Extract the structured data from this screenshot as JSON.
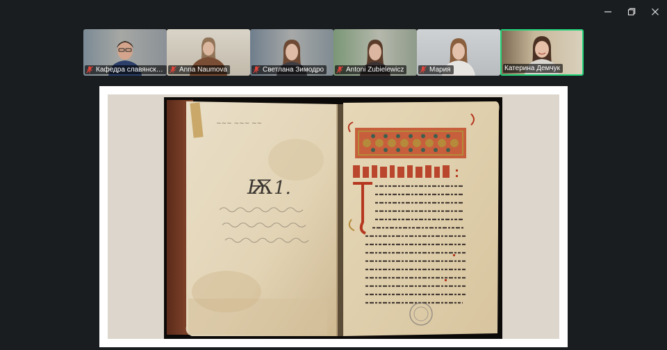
{
  "window": {
    "controls": {
      "minimize_icon": "minimize-icon",
      "maximize_icon": "maximize-icon",
      "close_icon": "close-icon"
    }
  },
  "participants": [
    {
      "name": "Кафедра славянской ...",
      "muted": true,
      "bg": "#8f9499"
    },
    {
      "name": "Anna Naumova",
      "muted": true,
      "bg": "#c5c0b5"
    },
    {
      "name": "Светлана Зимодро",
      "muted": true,
      "bg": "#9aa0a6"
    },
    {
      "name": "Antoni Zubielewicz",
      "muted": true,
      "bg": "#8fa38d"
    },
    {
      "name": "Мария",
      "muted": true,
      "bg": "#c2c6c9"
    },
    {
      "name": "Катерина Демчук",
      "muted": false,
      "bg": "#b7a98f",
      "active": true
    }
  ],
  "shared_content": {
    "manuscript_left_notes": [
      "Ѭ",
      "1."
    ],
    "colors": {
      "red_ink": "#b5371f",
      "gold": "#b58a3a",
      "page": "#e8dcc2"
    }
  },
  "colors": {
    "active_speaker": "#23d57b",
    "background": "#1a1d20"
  }
}
